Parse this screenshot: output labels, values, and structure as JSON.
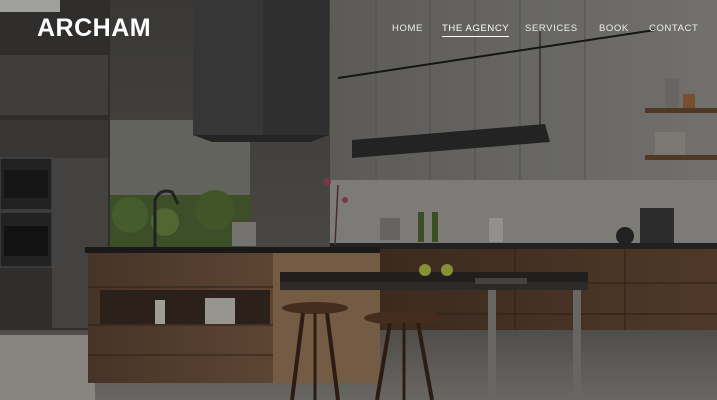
{
  "brand": {
    "logo_text": "ARCHAM"
  },
  "nav": {
    "items": [
      {
        "label": "HOME",
        "active": false
      },
      {
        "label": "THE AGENCY",
        "active": true
      },
      {
        "label": "SERVICES",
        "active": false
      },
      {
        "label": "BOOK",
        "active": false
      },
      {
        "label": "CONTACT",
        "active": false
      }
    ]
  },
  "colors": {
    "text": "#ffffff",
    "overlay": "#0a0a0a",
    "cabinet_wood": "#6b4a33",
    "cabinet_gloss": "#d8d8d6"
  }
}
